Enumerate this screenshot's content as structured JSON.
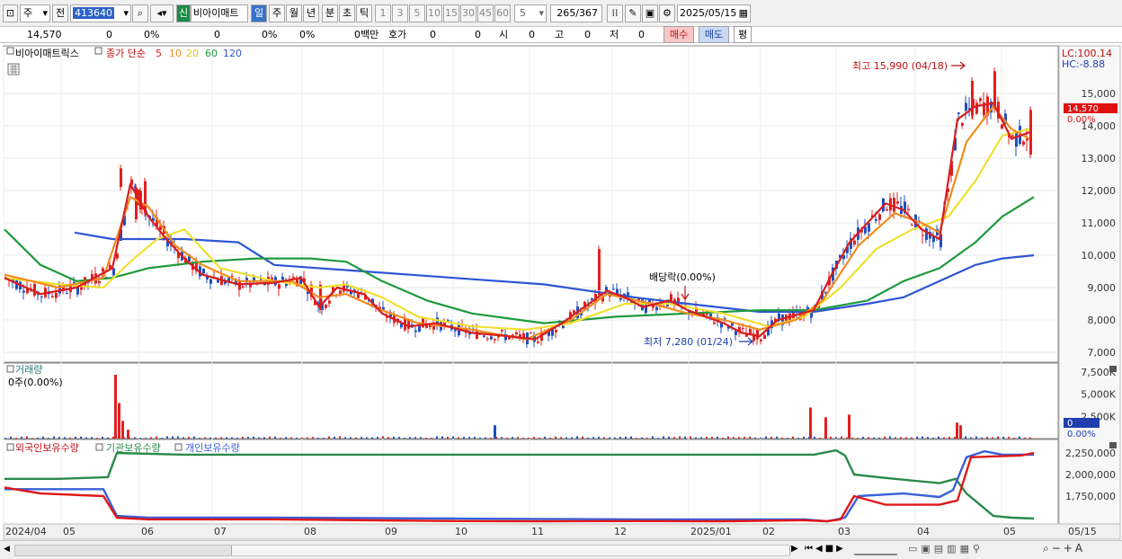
{
  "toolbar": {
    "type_label": "주",
    "prev_label": "전",
    "code_value": "413640",
    "badge_label": "신",
    "stock_name": "비아이매트",
    "periods": [
      "일",
      "주",
      "월",
      "년",
      "분",
      "초",
      "틱"
    ],
    "active_period": "일",
    "intervals": [
      "1",
      "3",
      "5",
      "10",
      "15",
      "30",
      "45",
      "60"
    ],
    "interval_value": "5",
    "count_value": "265",
    "count_total": "/367",
    "date_value": "2025/05/15"
  },
  "quote": {
    "price": "14,570",
    "change": "0",
    "change_pct": "0%",
    "v1": "0",
    "v1_pct": "0%",
    "v2_pct": "0%",
    "amount": "0백만",
    "bid_label": "호가",
    "bid1": "0",
    "bid2": "0",
    "open_label": "시",
    "open_value": "0",
    "high_label": "고",
    "high_value": "0",
    "low_label": "저",
    "low_value": "0",
    "buy_label": "매수",
    "sell_label": "매도",
    "flat_label": "평"
  },
  "price_pane": {
    "legend_name": "비아이매트릭스",
    "legend_ma_label": "종가 단순",
    "ma_periods": [
      "5",
      "10",
      "20",
      "60",
      "120"
    ],
    "lc_label": "LC:100.14",
    "hc_label": "HC:-8.88",
    "high_annotation": "최고 15,990 (04/18)",
    "low_annotation": "최저 7,280 (01/24)",
    "dividend_annotation": "배당락(0.00%)",
    "last_price_label": "14,570",
    "last_pct_label": "0.00%",
    "y_ticks": [
      "15,000",
      "14,000",
      "13,000",
      "12,000",
      "11,000",
      "10,000",
      "9,000",
      "8,000",
      "7,000"
    ]
  },
  "volume_pane": {
    "title": "거래량",
    "sub_label": "0주(0.00%)",
    "y_ticks": [
      "7,500K",
      "5,000K",
      "2,500K"
    ],
    "last_value_label": "0",
    "last_pct_label": "0.00%"
  },
  "holdings_pane": {
    "legend": [
      "외국인보유수량",
      "기관보유수량",
      "개인보유수량"
    ],
    "y_ticks": [
      "2,250,000",
      "2,000,000",
      "1,750,000"
    ]
  },
  "x_labels": [
    "2024/04",
    "05",
    "06",
    "07",
    "08",
    "09",
    "10",
    "11",
    "12",
    "2025/01",
    "02",
    "03",
    "04",
    "05",
    "05/15"
  ],
  "colors": {
    "up": "#e02020",
    "down": "#1f4fbf",
    "ma5": "#d81e1e",
    "ma10": "#f08c1e",
    "ma20": "#f0e030",
    "ma60": "#1e9a3c",
    "ma120": "#2f55d4",
    "foreign": "#e01818",
    "institution": "#2a8a4a",
    "individual": "#3a5fd8"
  },
  "chart_data": {
    "type": "candlestick",
    "price_yrange": [
      7000,
      15000
    ],
    "volume_yrange": [
      0,
      7500000
    ],
    "holdings_yrange": [
      1750000,
      2250000
    ],
    "ma5": [
      [
        0,
        9300
      ],
      [
        40,
        8800
      ],
      [
        80,
        9000
      ],
      [
        120,
        9600
      ],
      [
        140,
        12200
      ],
      [
        160,
        11200
      ],
      [
        180,
        10500
      ],
      [
        200,
        9900
      ],
      [
        220,
        9400
      ],
      [
        260,
        9100
      ],
      [
        300,
        9150
      ],
      [
        330,
        9300
      ],
      [
        350,
        8400
      ],
      [
        370,
        9000
      ],
      [
        400,
        8800
      ],
      [
        420,
        8200
      ],
      [
        450,
        7800
      ],
      [
        480,
        7900
      ],
      [
        520,
        7600
      ],
      [
        560,
        7500
      ],
      [
        590,
        7400
      ],
      [
        620,
        7900
      ],
      [
        650,
        8500
      ],
      [
        670,
        8900
      ],
      [
        690,
        8700
      ],
      [
        710,
        8400
      ],
      [
        740,
        8600
      ],
      [
        760,
        8300
      ],
      [
        780,
        8100
      ],
      [
        800,
        7900
      ],
      [
        820,
        7600
      ],
      [
        840,
        7500
      ],
      [
        860,
        8000
      ],
      [
        900,
        8300
      ],
      [
        920,
        9400
      ],
      [
        940,
        10400
      ],
      [
        960,
        11000
      ],
      [
        980,
        11600
      ],
      [
        1000,
        11400
      ],
      [
        1020,
        10800
      ],
      [
        1040,
        10500
      ],
      [
        1060,
        14200
      ],
      [
        1080,
        14600
      ],
      [
        1100,
        14700
      ],
      [
        1120,
        13600
      ],
      [
        1140,
        13800
      ]
    ],
    "ma10": [
      [
        0,
        9400
      ],
      [
        60,
        9000
      ],
      [
        110,
        9300
      ],
      [
        140,
        11800
      ],
      [
        160,
        11500
      ],
      [
        190,
        10300
      ],
      [
        220,
        9700
      ],
      [
        260,
        9200
      ],
      [
        320,
        9200
      ],
      [
        350,
        8700
      ],
      [
        380,
        8800
      ],
      [
        420,
        8300
      ],
      [
        460,
        7900
      ],
      [
        520,
        7700
      ],
      [
        580,
        7400
      ],
      [
        630,
        8000
      ],
      [
        670,
        8800
      ],
      [
        720,
        8500
      ],
      [
        760,
        8200
      ],
      [
        800,
        8000
      ],
      [
        840,
        7700
      ],
      [
        880,
        8000
      ],
      [
        910,
        8600
      ],
      [
        950,
        10300
      ],
      [
        990,
        11300
      ],
      [
        1020,
        11000
      ],
      [
        1040,
        10700
      ],
      [
        1070,
        13500
      ],
      [
        1100,
        14600
      ],
      [
        1120,
        13900
      ],
      [
        1140,
        13600
      ]
    ],
    "ma20": [
      [
        0,
        9300
      ],
      [
        60,
        9100
      ],
      [
        110,
        9000
      ],
      [
        140,
        9800
      ],
      [
        170,
        10500
      ],
      [
        200,
        10800
      ],
      [
        240,
        9600
      ],
      [
        300,
        9200
      ],
      [
        350,
        9000
      ],
      [
        380,
        9100
      ],
      [
        420,
        8700
      ],
      [
        460,
        8100
      ],
      [
        520,
        7800
      ],
      [
        580,
        7700
      ],
      [
        630,
        7900
      ],
      [
        690,
        8500
      ],
      [
        740,
        8500
      ],
      [
        800,
        8200
      ],
      [
        850,
        7800
      ],
      [
        890,
        8100
      ],
      [
        930,
        9000
      ],
      [
        970,
        10200
      ],
      [
        1010,
        10800
      ],
      [
        1050,
        11200
      ],
      [
        1080,
        12300
      ],
      [
        1110,
        13700
      ],
      [
        1140,
        13900
      ]
    ],
    "ma60": [
      [
        0,
        10800
      ],
      [
        40,
        9700
      ],
      [
        80,
        9200
      ],
      [
        120,
        9300
      ],
      [
        160,
        9600
      ],
      [
        220,
        9800
      ],
      [
        280,
        9900
      ],
      [
        340,
        9900
      ],
      [
        380,
        9800
      ],
      [
        420,
        9200
      ],
      [
        470,
        8600
      ],
      [
        520,
        8200
      ],
      [
        600,
        7900
      ],
      [
        680,
        8100
      ],
      [
        760,
        8200
      ],
      [
        840,
        8300
      ],
      [
        900,
        8300
      ],
      [
        960,
        8600
      ],
      [
        1000,
        9200
      ],
      [
        1040,
        9600
      ],
      [
        1080,
        10400
      ],
      [
        1110,
        11200
      ],
      [
        1145,
        11800
      ]
    ],
    "ma120": [
      [
        78,
        10700
      ],
      [
        120,
        10500
      ],
      [
        200,
        10500
      ],
      [
        260,
        10400
      ],
      [
        300,
        9700
      ],
      [
        400,
        9500
      ],
      [
        500,
        9300
      ],
      [
        600,
        9100
      ],
      [
        700,
        8700
      ],
      [
        760,
        8500
      ],
      [
        840,
        8250
      ],
      [
        900,
        8250
      ],
      [
        960,
        8500
      ],
      [
        1000,
        8700
      ],
      [
        1040,
        9200
      ],
      [
        1080,
        9700
      ],
      [
        1110,
        9900
      ],
      [
        1145,
        10000
      ]
    ],
    "highlight_candles": [
      [
        145,
        11000,
        12200
      ],
      [
        150,
        11300,
        12100
      ],
      [
        155,
        11200,
        12400
      ],
      [
        128,
        12000,
        12800
      ],
      [
        340,
        8600,
        9200
      ],
      [
        350,
        8200,
        9200
      ],
      [
        660,
        8800,
        10300
      ],
      [
        1075,
        14200,
        15500
      ],
      [
        1100,
        14400,
        15800
      ],
      [
        1140,
        13000,
        14600
      ]
    ],
    "volume_spikes": [
      [
        122,
        7200000
      ],
      [
        126,
        4000000
      ],
      [
        130,
        2000000
      ],
      [
        136,
        1000000
      ],
      [
        544,
        1500000
      ],
      [
        895,
        3500000
      ],
      [
        912,
        2400000
      ],
      [
        938,
        2700000
      ],
      [
        1058,
        1800000
      ],
      [
        1062,
        1500000
      ]
    ],
    "foreign": [
      [
        0,
        1850000
      ],
      [
        40,
        1780000
      ],
      [
        110,
        1750000
      ],
      [
        125,
        1500000
      ],
      [
        160,
        1480000
      ],
      [
        300,
        1480000
      ],
      [
        500,
        1460000
      ],
      [
        600,
        1450000
      ],
      [
        700,
        1460000
      ],
      [
        800,
        1450000
      ],
      [
        890,
        1470000
      ],
      [
        915,
        1430000
      ],
      [
        930,
        1480000
      ],
      [
        945,
        1750000
      ],
      [
        980,
        1650000
      ],
      [
        1040,
        1650000
      ],
      [
        1060,
        1700000
      ],
      [
        1075,
        2200000
      ],
      [
        1100,
        2210000
      ],
      [
        1130,
        2220000
      ],
      [
        1145,
        2250000
      ]
    ],
    "institution": [
      [
        0,
        1950000
      ],
      [
        60,
        1950000
      ],
      [
        115,
        1970000
      ],
      [
        125,
        2250000
      ],
      [
        200,
        2230000
      ],
      [
        400,
        2230000
      ],
      [
        600,
        2230000
      ],
      [
        800,
        2230000
      ],
      [
        900,
        2230000
      ],
      [
        925,
        2280000
      ],
      [
        935,
        2220000
      ],
      [
        945,
        2000000
      ],
      [
        980,
        1960000
      ],
      [
        1040,
        1900000
      ],
      [
        1058,
        1950000
      ],
      [
        1070,
        1780000
      ],
      [
        1100,
        1520000
      ],
      [
        1120,
        1500000
      ],
      [
        1145,
        1490000
      ]
    ],
    "individual": [
      [
        0,
        1830000
      ],
      [
        110,
        1830000
      ],
      [
        125,
        1520000
      ],
      [
        160,
        1500000
      ],
      [
        300,
        1500000
      ],
      [
        500,
        1490000
      ],
      [
        700,
        1480000
      ],
      [
        850,
        1480000
      ],
      [
        890,
        1480000
      ],
      [
        915,
        1450000
      ],
      [
        935,
        1500000
      ],
      [
        950,
        1750000
      ],
      [
        1000,
        1780000
      ],
      [
        1040,
        1740000
      ],
      [
        1055,
        1820000
      ],
      [
        1070,
        2200000
      ],
      [
        1090,
        2270000
      ],
      [
        1110,
        2230000
      ],
      [
        1145,
        2230000
      ]
    ]
  }
}
